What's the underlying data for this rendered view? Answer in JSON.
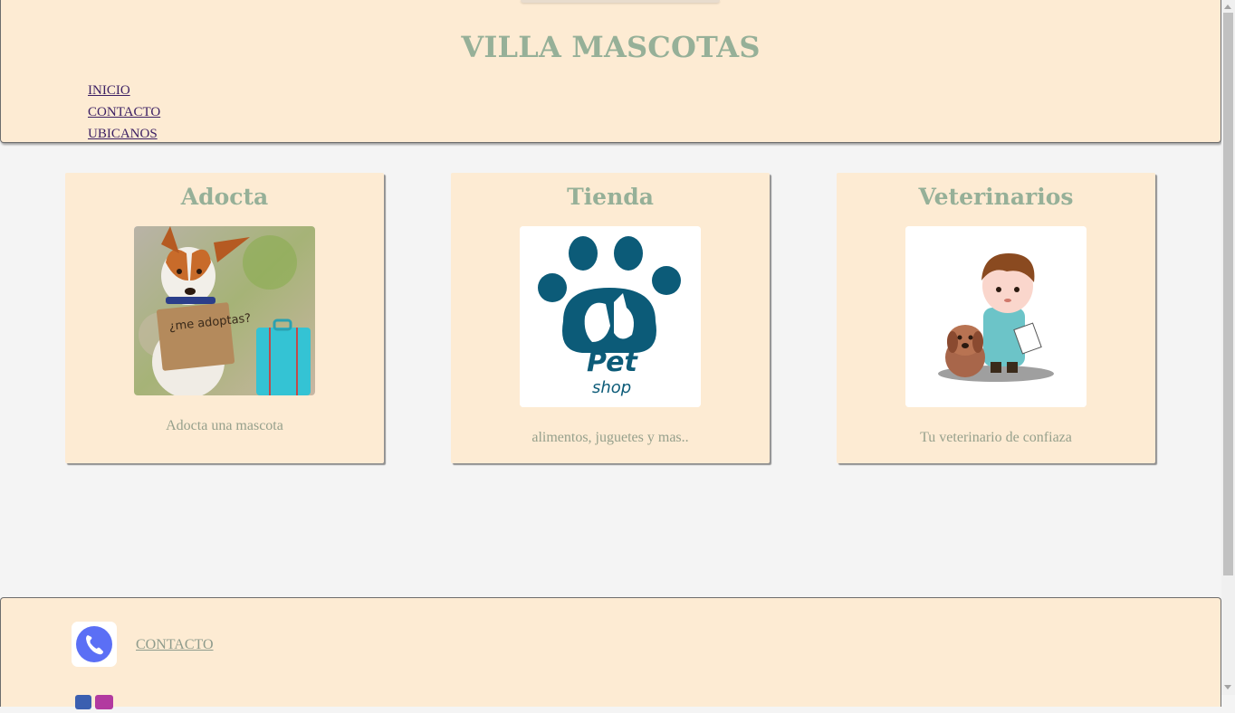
{
  "header": {
    "title": "VILLA MASCOTAS",
    "nav": [
      "INICIO",
      "CONTACTO",
      "UBICANOS"
    ]
  },
  "cards": [
    {
      "title": "Adocta",
      "image_icon": "dog-adoption-photo",
      "image_text": "¿me adoptas?",
      "caption": "Adocta una mascota"
    },
    {
      "title": "Tienda",
      "image_icon": "pet-shop-paw-logo",
      "image_text_1": "Pet",
      "image_text_2": "shop",
      "caption": "alimentos, juguetes y mas.."
    },
    {
      "title": "Veterinarios",
      "image_icon": "veterinarian-illustration",
      "caption": "Tu veterinario de confiaza"
    }
  ],
  "footer": {
    "contact_icon": "phone-icon",
    "contact_label": "CONTACTO",
    "social_icon": "instagram-icon"
  },
  "colors": {
    "accent": "#96b098",
    "panel": "#fdebd3",
    "background": "#f4f4f4",
    "phone": "#5b6ff5",
    "paw": "#0c5b78"
  }
}
